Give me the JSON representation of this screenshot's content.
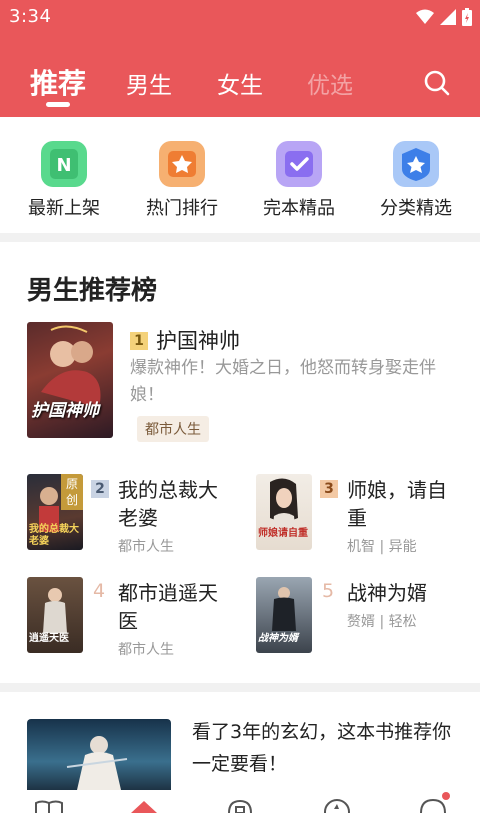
{
  "status": {
    "time": "3:34"
  },
  "tabs": [
    {
      "label": "推荐"
    },
    {
      "label": "男生"
    },
    {
      "label": "女生"
    },
    {
      "label": "优选"
    }
  ],
  "categories": [
    {
      "label": "最新上架",
      "icon": "new-icon",
      "color": "#3fcf7b"
    },
    {
      "label": "热门排行",
      "icon": "trophy-icon",
      "color": "#f08a3a"
    },
    {
      "label": "完本精品",
      "icon": "check-icon",
      "color": "#8d6ef0"
    },
    {
      "label": "分类精选",
      "icon": "star-icon",
      "color": "#3d84f0"
    }
  ],
  "section": {
    "title": "男生推荐榜"
  },
  "top_book": {
    "rank": "1",
    "title": "护国神帅",
    "desc": "爆款神作！大婚之日，他怒而转身娶走伴娘！",
    "tag": "都市人生",
    "cover_text": "护国神帅"
  },
  "books": [
    {
      "rank": "2",
      "title": "我的总裁大老婆",
      "meta": "都市人生",
      "cover_text": "我的总裁大老婆",
      "ribbon": "原创"
    },
    {
      "rank": "3",
      "title": "师娘，请自重",
      "meta": "机智 | 异能",
      "cover_text": "师娘请自重"
    },
    {
      "rank": "4",
      "title": "都市逍遥天医",
      "meta": "都市人生",
      "cover_text": "逍遥天医"
    },
    {
      "rank": "5",
      "title": "战神为婿",
      "meta": "赘婿 | 轻松",
      "cover_text": "战神为婿"
    }
  ],
  "feature": {
    "text": "看了3年的玄幻，这本书推荐你一定要看！"
  }
}
